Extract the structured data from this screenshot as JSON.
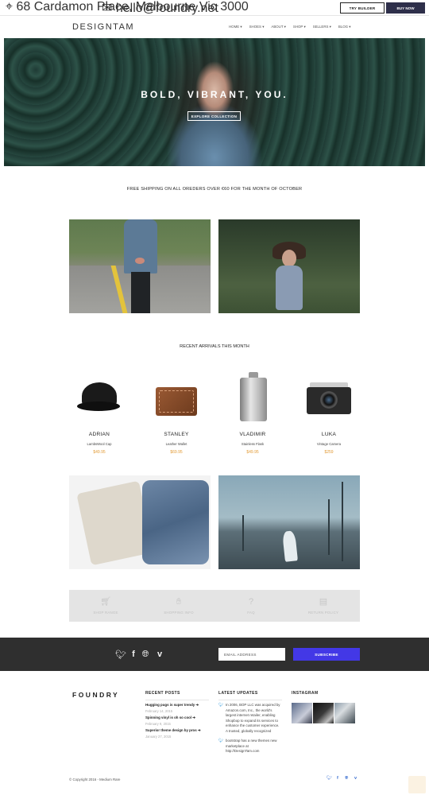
{
  "topbar": {
    "address": "68 Cardamon Place, Melbourne Vic 3000",
    "email": "hello@foundry.net",
    "try_builder": "TRY BUILDER",
    "buy_now": "BUY NOW"
  },
  "header": {
    "logo": "DESIGNTAM",
    "nav": [
      "HOME ▾",
      "SHOES ▾",
      "ABOUT ▾",
      "SHOP ▾",
      "SELLERS ▾",
      "BLOG ▾"
    ]
  },
  "hero": {
    "title": "BOLD, VIBRANT, YOU.",
    "button": "EXPLORE COLLECTION"
  },
  "shipping_banner": "FREE SHIPPING ON ALL OREDERS OVER €60 FOR THE MONTH OF OCTOBER",
  "recent": {
    "title": "RECENT ARRIVALS THIS MONTH",
    "products": [
      {
        "name": "ADRIAN",
        "desc": "LambsWool Cap",
        "price": "$49.95"
      },
      {
        "name": "STANLEY",
        "desc": "Leather Wallet",
        "price": "$69.95"
      },
      {
        "name": "VLADIMIR",
        "desc": "Stainless Flask",
        "price": "$49.95"
      },
      {
        "name": "LUKA",
        "desc": "Vintage Camera",
        "price": "$259"
      }
    ]
  },
  "features": [
    {
      "label": "SHOP RANGE",
      "icon": "cart-icon"
    },
    {
      "label": "SHOPPING INFO",
      "icon": "handshake-icon"
    },
    {
      "label": "FAQ",
      "icon": "question-icon"
    },
    {
      "label": "RETURN POLICY",
      "icon": "document-icon"
    }
  ],
  "subscribe": {
    "social_icons": [
      "twitter-icon",
      "facebook-icon",
      "globe-icon",
      "vimeo-icon"
    ],
    "email_placeholder": "EMAIL ADDRESS",
    "button": "SUBSCRIBE",
    "button_color": "#4338e6"
  },
  "footer": {
    "logo": "FOUNDRY",
    "recent_posts": {
      "heading": "RECENT POSTS",
      "posts": [
        {
          "title": "Hugging pugs is super trendy ➔",
          "date": "February 14, 2015"
        },
        {
          "title": "Spinning vinyl is oh so cool ➔",
          "date": "February 9, 2015"
        },
        {
          "title": "Superior theme design by pros ➔",
          "date": "January 27, 2015"
        }
      ]
    },
    "latest_updates": {
      "heading": "LATEST UPDATES",
      "updates": [
        "In 2006, BOP LLC was acquired by Amazon.com, Inc., the world's largest internet retailer, enabling Shopbop to expand its services to enhance the customer experience. A trusted, globally recognized",
        "bootstrap has a new themes new marketplace at http://DesignTam.com"
      ]
    },
    "instagram": {
      "heading": "INSTAGRAM"
    },
    "copyright": "© Copyright 2016 - Medium Rare",
    "social_icons": [
      "twitter-icon",
      "facebook-icon",
      "globe-icon",
      "vimeo-icon"
    ]
  },
  "colors": {
    "accent_price": "#e29a35",
    "dark_band": "#2f2f2f",
    "buy_button": "#2e2f4a"
  }
}
